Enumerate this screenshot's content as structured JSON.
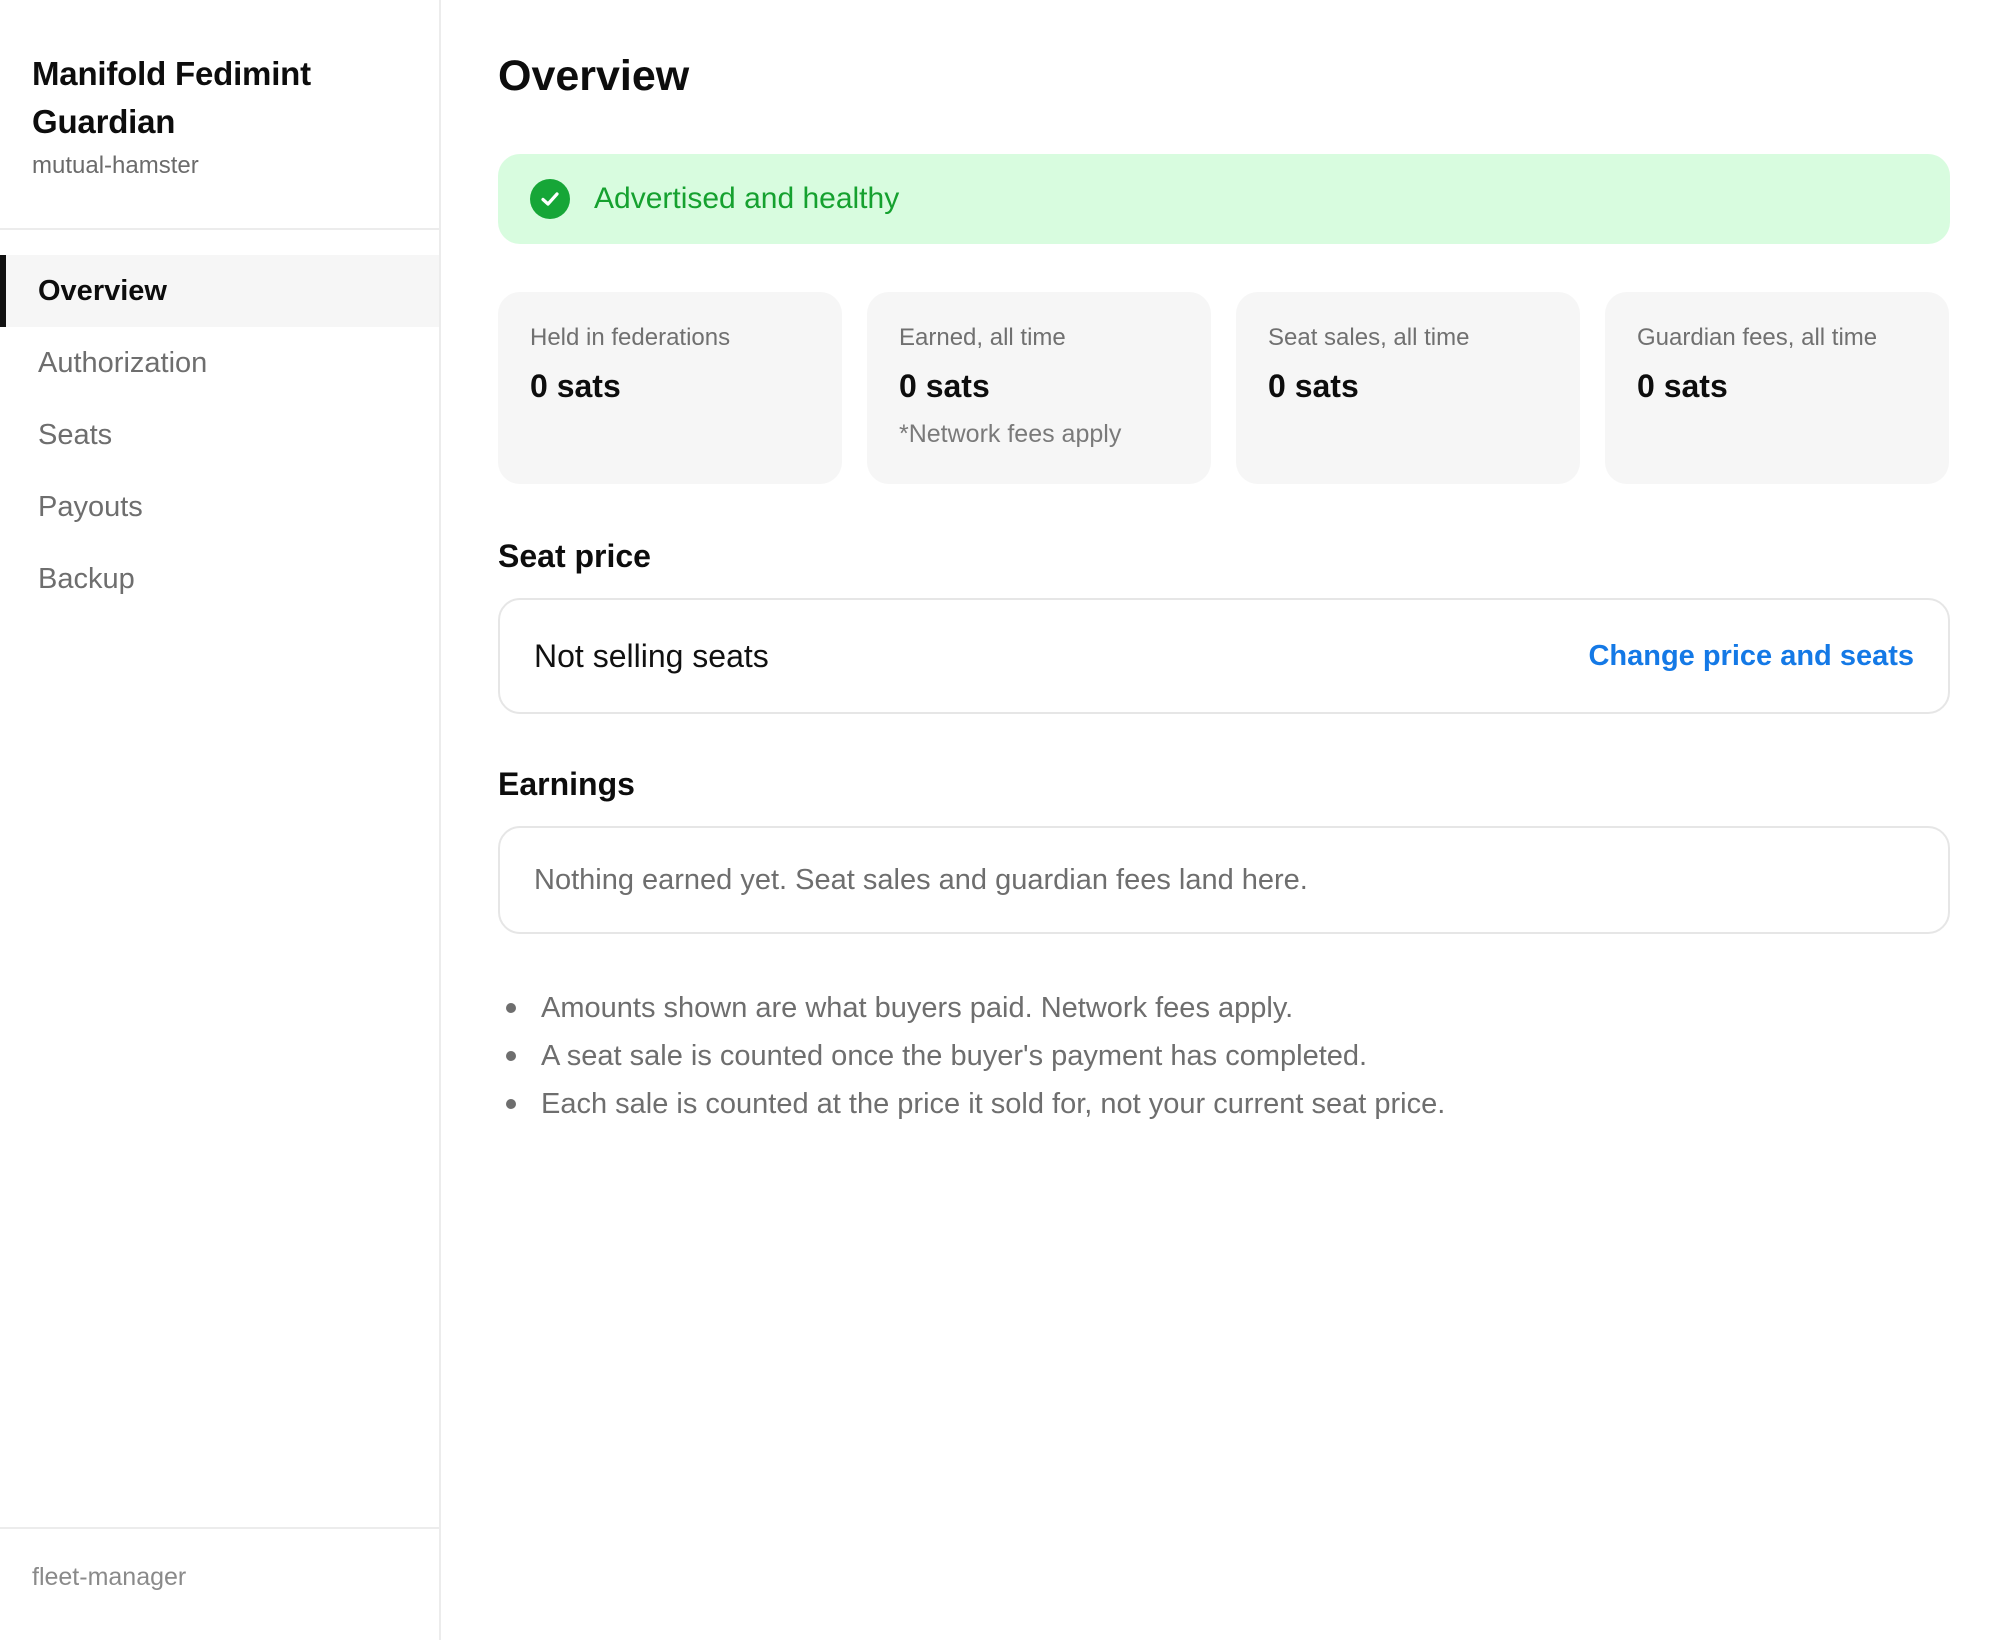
{
  "sidebar": {
    "brand_title": "Manifold Fedimint Guardian",
    "brand_subtitle": "mutual-hamster",
    "nav": [
      {
        "label": "Overview",
        "active": true
      },
      {
        "label": "Authorization",
        "active": false
      },
      {
        "label": "Seats",
        "active": false
      },
      {
        "label": "Payouts",
        "active": false
      },
      {
        "label": "Backup",
        "active": false
      }
    ],
    "footer": "fleet-manager"
  },
  "main": {
    "title": "Overview",
    "status": {
      "text": "Advertised and healthy",
      "icon": "check-circle-icon",
      "color": "#16a637",
      "background": "#d8fcdf"
    },
    "stats": [
      {
        "label": "Held in federations",
        "value": "0 sats",
        "note": ""
      },
      {
        "label": "Earned, all time",
        "value": "0 sats",
        "note": "*Network fees apply"
      },
      {
        "label": "Seat sales, all time",
        "value": "0 sats",
        "note": ""
      },
      {
        "label": "Guardian fees, all time",
        "value": "0 sats",
        "note": ""
      }
    ],
    "seat_price": {
      "title": "Seat price",
      "status": "Not selling seats",
      "action": "Change price and seats",
      "action_color": "#1479e6"
    },
    "earnings": {
      "title": "Earnings",
      "empty_text": "Nothing earned yet. Seat sales and guardian fees land here."
    },
    "notes": [
      "Amounts shown are what buyers paid. Network fees apply.",
      "A seat sale is counted once the buyer's payment has completed.",
      "Each sale is counted at the price it sold for, not your current seat price."
    ]
  }
}
